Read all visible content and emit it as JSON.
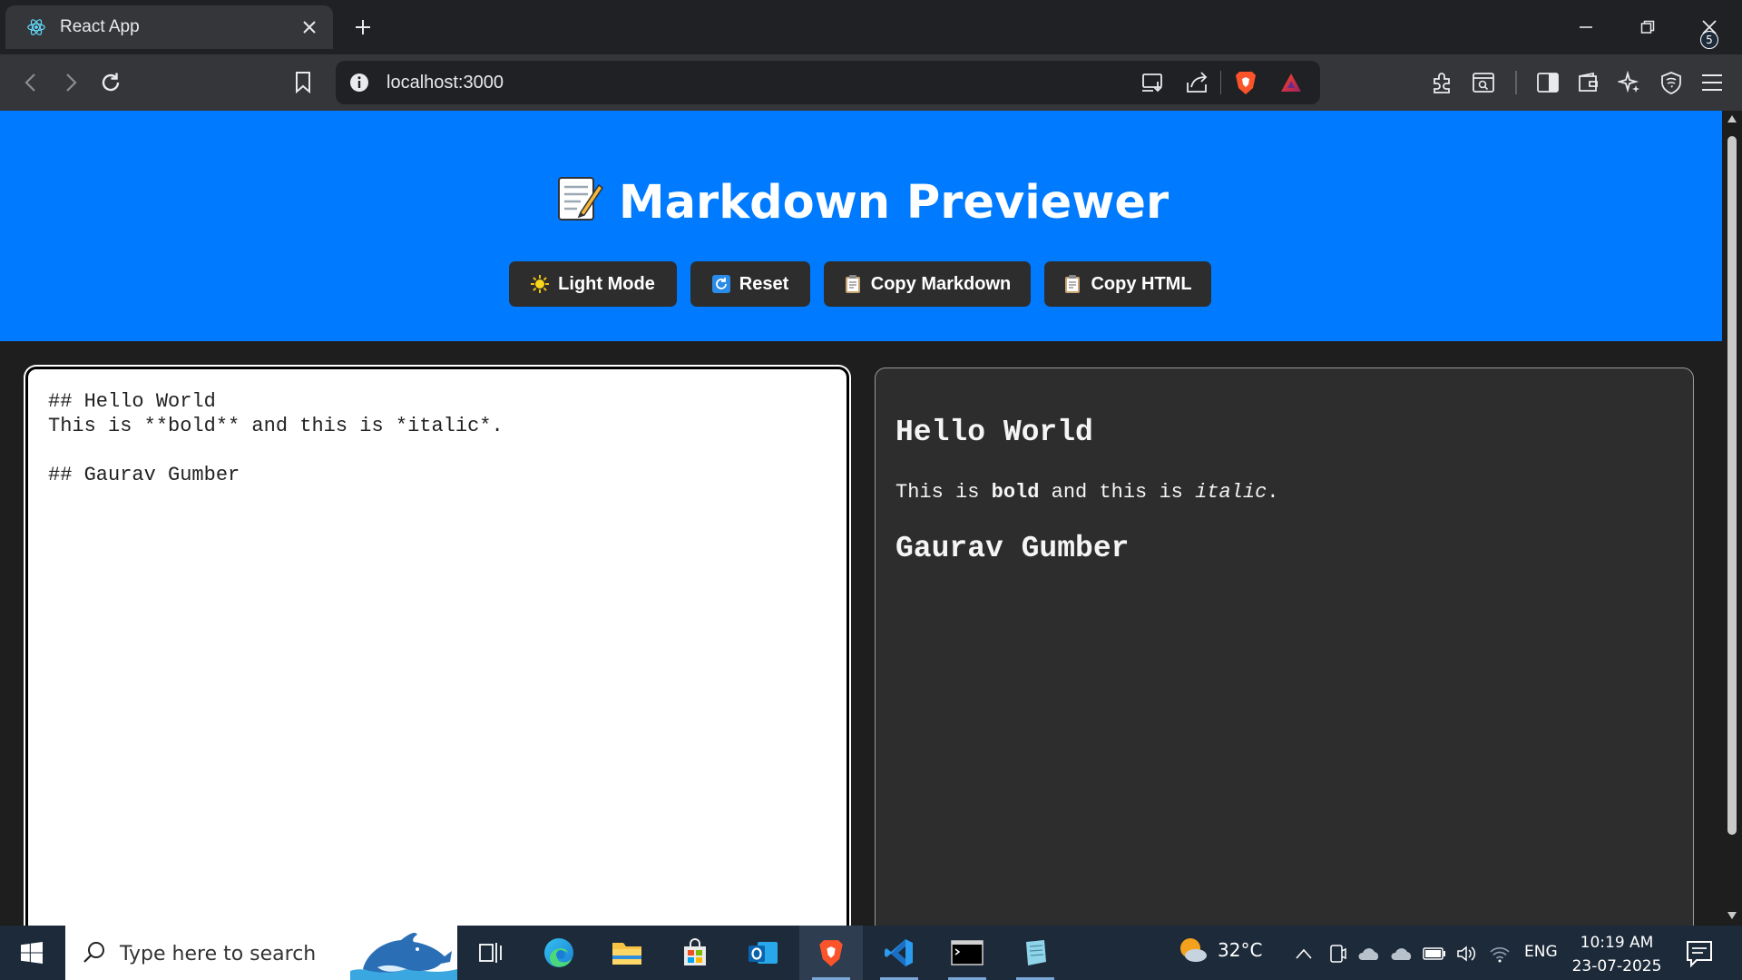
{
  "browser": {
    "tab_title": "React App",
    "url": "localhost:3000"
  },
  "page": {
    "title_emoji": "📝",
    "title": "Markdown Previewer",
    "buttons": [
      {
        "icon": "sun-icon",
        "emoji": "🌞",
        "label": "Light Mode"
      },
      {
        "icon": "refresh-icon",
        "emoji": "🔄",
        "label": "Reset"
      },
      {
        "icon": "clipboard-icon",
        "emoji": "📋",
        "label": "Copy Markdown"
      },
      {
        "icon": "clipboard-icon",
        "emoji": "📋",
        "label": "Copy HTML"
      }
    ],
    "editor_lines": [
      "## Hello World",
      "This is **bold** and this is *italic*.",
      "",
      "## Gaurav Gumber"
    ],
    "preview": {
      "heading1": "Hello World",
      "paragraph": {
        "before_bold": "This is ",
        "bold": "bold",
        "middle": " and this is ",
        "italic": "italic",
        "after": "."
      },
      "heading2": "Gaurav Gumber"
    }
  },
  "taskbar": {
    "search_placeholder": "Type here to search",
    "weather": "32°C",
    "language": "ENG",
    "time": "10:19 AM",
    "date": "23-07-2025",
    "notification_count": "5"
  },
  "colors": {
    "header_bg": "#007bff",
    "page_bg": "#1e1e1e",
    "button_bg": "#2d2d2d",
    "preview_bg": "#2d2d2d"
  }
}
